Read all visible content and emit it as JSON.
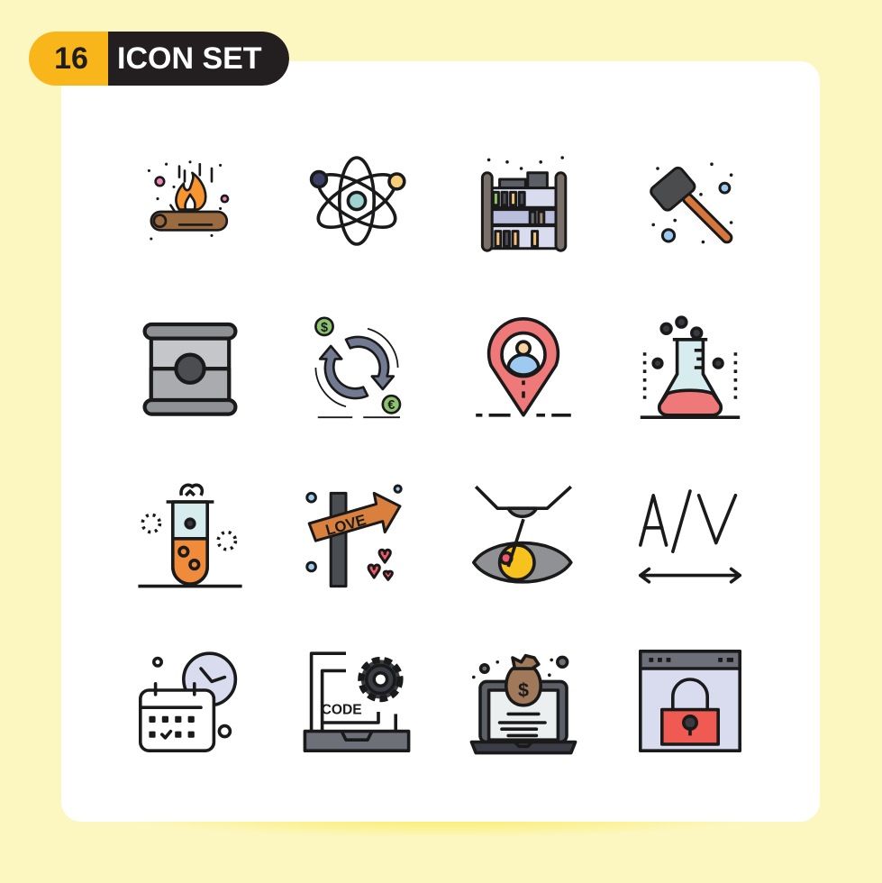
{
  "badge": {
    "number": "16",
    "label": "ICON SET"
  },
  "colors": {
    "background": "#fcf7c0",
    "badge_accent": "#f9b61a",
    "badge_dark": "#231f20",
    "card": "#ffffff"
  },
  "icons": [
    {
      "name": "campfire-icon"
    },
    {
      "name": "atom-icon"
    },
    {
      "name": "bookshelf-icon"
    },
    {
      "name": "hammer-icon"
    },
    {
      "name": "barrel-icon"
    },
    {
      "name": "currency-exchange-icon",
      "symbols": [
        "$",
        "€"
      ]
    },
    {
      "name": "user-location-pin-icon"
    },
    {
      "name": "chemistry-flask-icon"
    },
    {
      "name": "test-tube-icon"
    },
    {
      "name": "love-signpost-icon",
      "text": "LOVE"
    },
    {
      "name": "eye-laser-icon"
    },
    {
      "name": "kerning-icon",
      "text": "A/V"
    },
    {
      "name": "calendar-clock-icon"
    },
    {
      "name": "code-settings-laptop-icon",
      "text": "CODE"
    },
    {
      "name": "laptop-money-bag-icon",
      "symbol": "$"
    },
    {
      "name": "browser-lock-icon"
    }
  ]
}
